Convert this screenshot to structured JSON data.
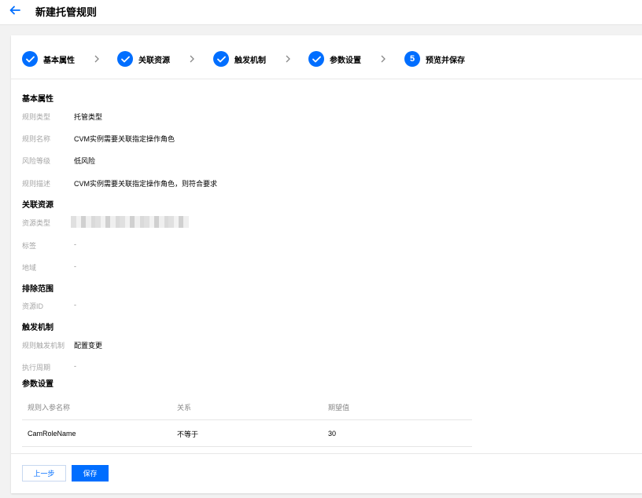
{
  "header": {
    "title": "新建托管规则"
  },
  "steps": [
    {
      "label": "基本属性",
      "status": "done"
    },
    {
      "label": "关联资源",
      "status": "done"
    },
    {
      "label": "触发机制",
      "status": "done"
    },
    {
      "label": "参数设置",
      "status": "done"
    },
    {
      "label": "预览并保存",
      "status": "current",
      "number": "5"
    }
  ],
  "basic": {
    "title": "基本属性",
    "rule_type_label": "规则类型",
    "rule_type_value": "托管类型",
    "rule_name_label": "规则名称",
    "rule_name_value": "CVM实例需要关联指定操作角色",
    "risk_label": "风险等级",
    "risk_value": "低风险",
    "desc_label": "规则描述",
    "desc_value": "CVM实例需要关联指定操作角色，则符合要求"
  },
  "resources": {
    "title": "关联资源",
    "type_label": "资源类型",
    "tag_label": "标签",
    "tag_value": "-",
    "region_label": "地域",
    "region_value": "-"
  },
  "exclusion": {
    "title": "排除范围",
    "id_label": "资源ID",
    "id_value": "-"
  },
  "trigger": {
    "title": "触发机制",
    "mech_label": "规则触发机制",
    "mech_value": "配置变更",
    "period_label": "执行周期",
    "period_value": "-"
  },
  "params": {
    "title": "参数设置",
    "columns": [
      "规则入参名称",
      "关系",
      "期望值"
    ],
    "rows": [
      [
        "CamRoleName",
        "不等于",
        "30"
      ]
    ]
  },
  "buttons": {
    "prev": "上一步",
    "save": "保存"
  },
  "colors": {
    "accent": "#006eff",
    "label_gray": "#a6a6a6"
  }
}
